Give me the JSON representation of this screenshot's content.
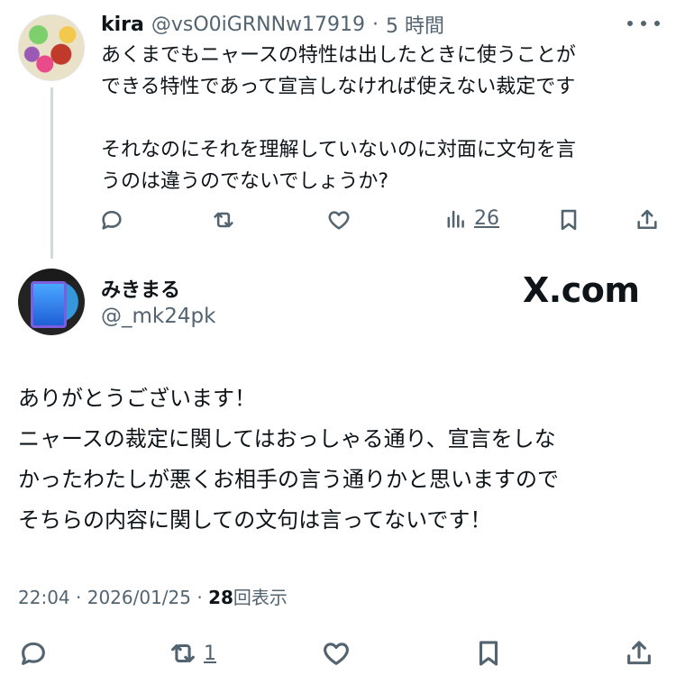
{
  "tweet1": {
    "name": "kira",
    "handle": "@vsO0iGRNNw17919",
    "separator": "·",
    "time": "5 時間",
    "lines": [
      "あくまでもニャースの特性は出したときに使うことが",
      "できる特性であって宣言しなければ使えない裁定です",
      "それなのにそれを理解していないのに対面に文句を言",
      "うのは違うのでないでしょうか?"
    ],
    "views": "26",
    "icons": [
      "reply-icon",
      "retweet-icon",
      "like-icon",
      "views-icon",
      "bookmark-icon",
      "share-icon",
      "more-icon"
    ]
  },
  "tweet2": {
    "name": "みきまる",
    "handle": "@_mk24pk",
    "watermark": "X.com",
    "lines": [
      "ありがとうございます！",
      "ニャースの裁定に関してはおっしゃる通り、宣言をしな",
      "かったわたしが悪くお相手の言う通りかと思いますので",
      "そちらの内容に関しての文句は言ってないです！"
    ],
    "time": "22:04",
    "sep": "·",
    "date": "2026/01/25",
    "views": "28",
    "views_label": "回表示",
    "retweets": "1"
  },
  "colors": {
    "text": "#0f1419",
    "muted": "#536471",
    "thread_line": "#cfd9de"
  }
}
